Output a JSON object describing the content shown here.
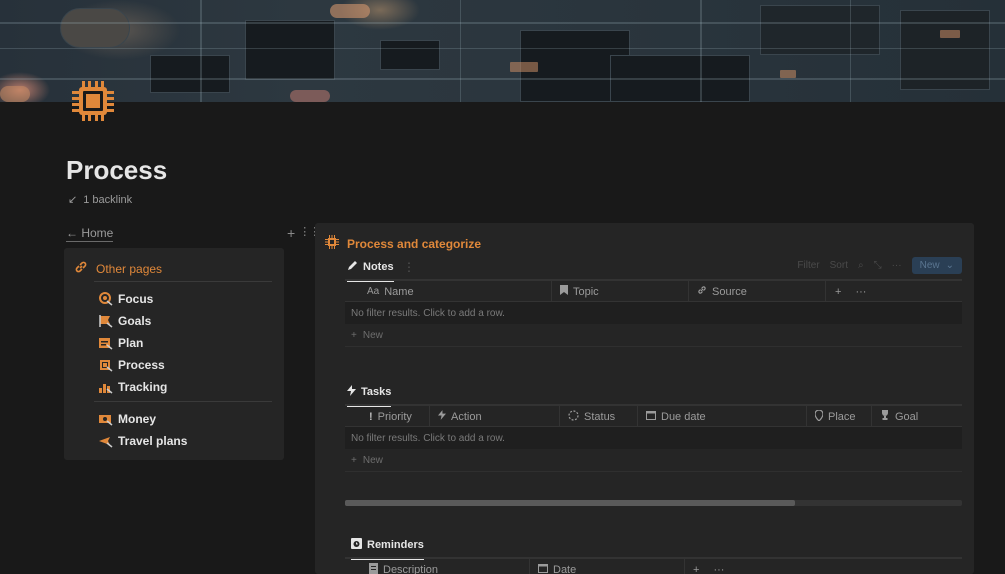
{
  "page": {
    "title": "Process",
    "backlink_label": "1 backlink",
    "home_link": "← Home",
    "accent": "#e0883a"
  },
  "callout": {
    "heading": "Other pages",
    "items": [
      {
        "label": "Focus",
        "icon": "focus-icon"
      },
      {
        "label": "Goals",
        "icon": "goals-icon"
      },
      {
        "label": "Plan",
        "icon": "plan-icon"
      },
      {
        "label": "Process",
        "icon": "process-icon"
      },
      {
        "label": "Tracking",
        "icon": "tracking-icon"
      },
      {
        "label": "Money",
        "icon": "money-icon"
      },
      {
        "label": "Travel plans",
        "icon": "travel-plans-icon"
      }
    ]
  },
  "panel": {
    "heading": "Process and categorize",
    "toolbar": {
      "filter": "Filter",
      "sort": "Sort",
      "new_label": "New"
    },
    "notes": {
      "tab": "Notes",
      "columns": [
        {
          "label": "Name",
          "icon": "text-icon"
        },
        {
          "label": "Topic",
          "icon": "bookmark-icon"
        },
        {
          "label": "Source",
          "icon": "link-icon"
        }
      ],
      "empty": "No filter results. Click to add a row.",
      "new_row": "New"
    },
    "tasks": {
      "tab": "Tasks",
      "columns": [
        {
          "label": "Priority",
          "icon": "exclamation-icon"
        },
        {
          "label": "Action",
          "icon": "bolt-icon"
        },
        {
          "label": "Status",
          "icon": "status-icon"
        },
        {
          "label": "Due date",
          "icon": "calendar-icon"
        },
        {
          "label": "Place",
          "icon": "pin-icon"
        },
        {
          "label": "Goal",
          "icon": "trophy-icon"
        }
      ],
      "empty": "No filter results. Click to add a row.",
      "new_row": "New",
      "scroll_fraction": 0.73
    },
    "reminders": {
      "tab": "Reminders",
      "columns": [
        {
          "label": "Description",
          "icon": "description-icon"
        },
        {
          "label": "Date",
          "icon": "calendar-icon"
        }
      ]
    }
  }
}
